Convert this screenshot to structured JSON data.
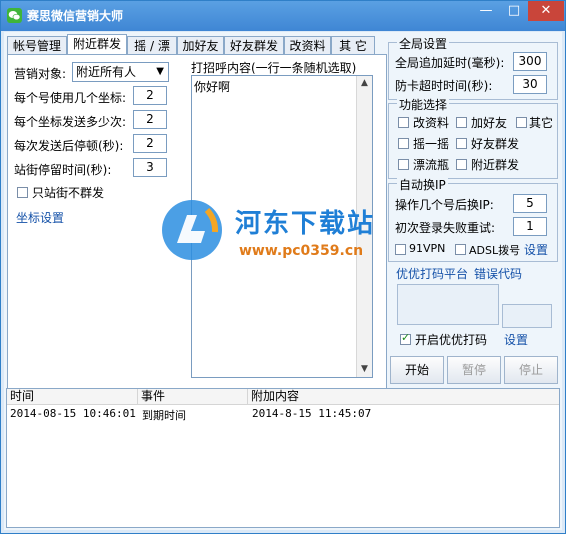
{
  "window": {
    "title": "赛思微信营销大师",
    "minimize_glyph": "—",
    "maximize_glyph": "□",
    "close_glyph": "✕"
  },
  "tabs": [
    {
      "label": "帐号管理"
    },
    {
      "label": "附近群发"
    },
    {
      "label": "摇 / 漂"
    },
    {
      "label": "加好友"
    },
    {
      "label": "好友群发"
    },
    {
      "label": "改资料"
    },
    {
      "label": "其 它"
    }
  ],
  "nearby": {
    "target_label": "营销对象:",
    "target_value": "附近所有人",
    "coords_per_account_label": "每个号使用几个坐标:",
    "coords_per_account_value": "2",
    "send_per_coord_label": "每个坐标发送多少次:",
    "send_per_coord_value": "2",
    "pause_after_send_label": "每次发送后停顿(秒):",
    "pause_after_send_value": "2",
    "stay_time_label": "站街停留时间(秒):",
    "stay_time_value": "3",
    "only_stay_label": "只站街不群发",
    "only_stay_checked": false,
    "coord_settings_link": "坐标设置",
    "greeting_label": "打招呼内容(一行一条随机选取)",
    "greeting_text": "你好啊"
  },
  "global_settings": {
    "title": "全局设置",
    "delay_label": "全局追加延时(毫秒):",
    "delay_value": "300",
    "timeout_label": "防卡超时时间(秒):",
    "timeout_value": "30"
  },
  "features": {
    "title": "功能选择",
    "items": [
      {
        "label": "改资料",
        "checked": false
      },
      {
        "label": "加好友",
        "checked": false
      },
      {
        "label": "其它",
        "checked": false
      },
      {
        "label": "摇一摇",
        "checked": false
      },
      {
        "label": "好友群发",
        "checked": false
      },
      {
        "label": "漂流瓶",
        "checked": false
      },
      {
        "label": "附近群发",
        "checked": false
      }
    ]
  },
  "auto_ip": {
    "title": "自动换IP",
    "switch_after_label": "操作几个号后换IP:",
    "switch_after_value": "5",
    "retry_label": "初次登录失败重试:",
    "retry_value": "1",
    "vpn_label": "91VPN",
    "adsl_label": "ADSL拨号",
    "settings_link": "设置"
  },
  "captcha": {
    "platform_label": "优优打码平台",
    "error_link": "错误代码",
    "enable_label": "开启优优打码",
    "enable_checked": true,
    "settings_link": "设置"
  },
  "actions": {
    "start": "开始",
    "pause": "暂停",
    "stop": "停止"
  },
  "log": {
    "columns": [
      "时间",
      "事件",
      "附加内容"
    ],
    "rows": [
      {
        "time": "2014-08-15 10:46:01",
        "event": "到期时间",
        "extra": "2014-8-15 11:45:07"
      }
    ]
  },
  "watermark": {
    "name": "河东下载站",
    "url": "www.pc0359.cn"
  },
  "colors": {
    "title_bar": "#3f86d4",
    "close_button": "#c9453a",
    "link": "#1451a8",
    "watermark": "#1f7fd6"
  }
}
